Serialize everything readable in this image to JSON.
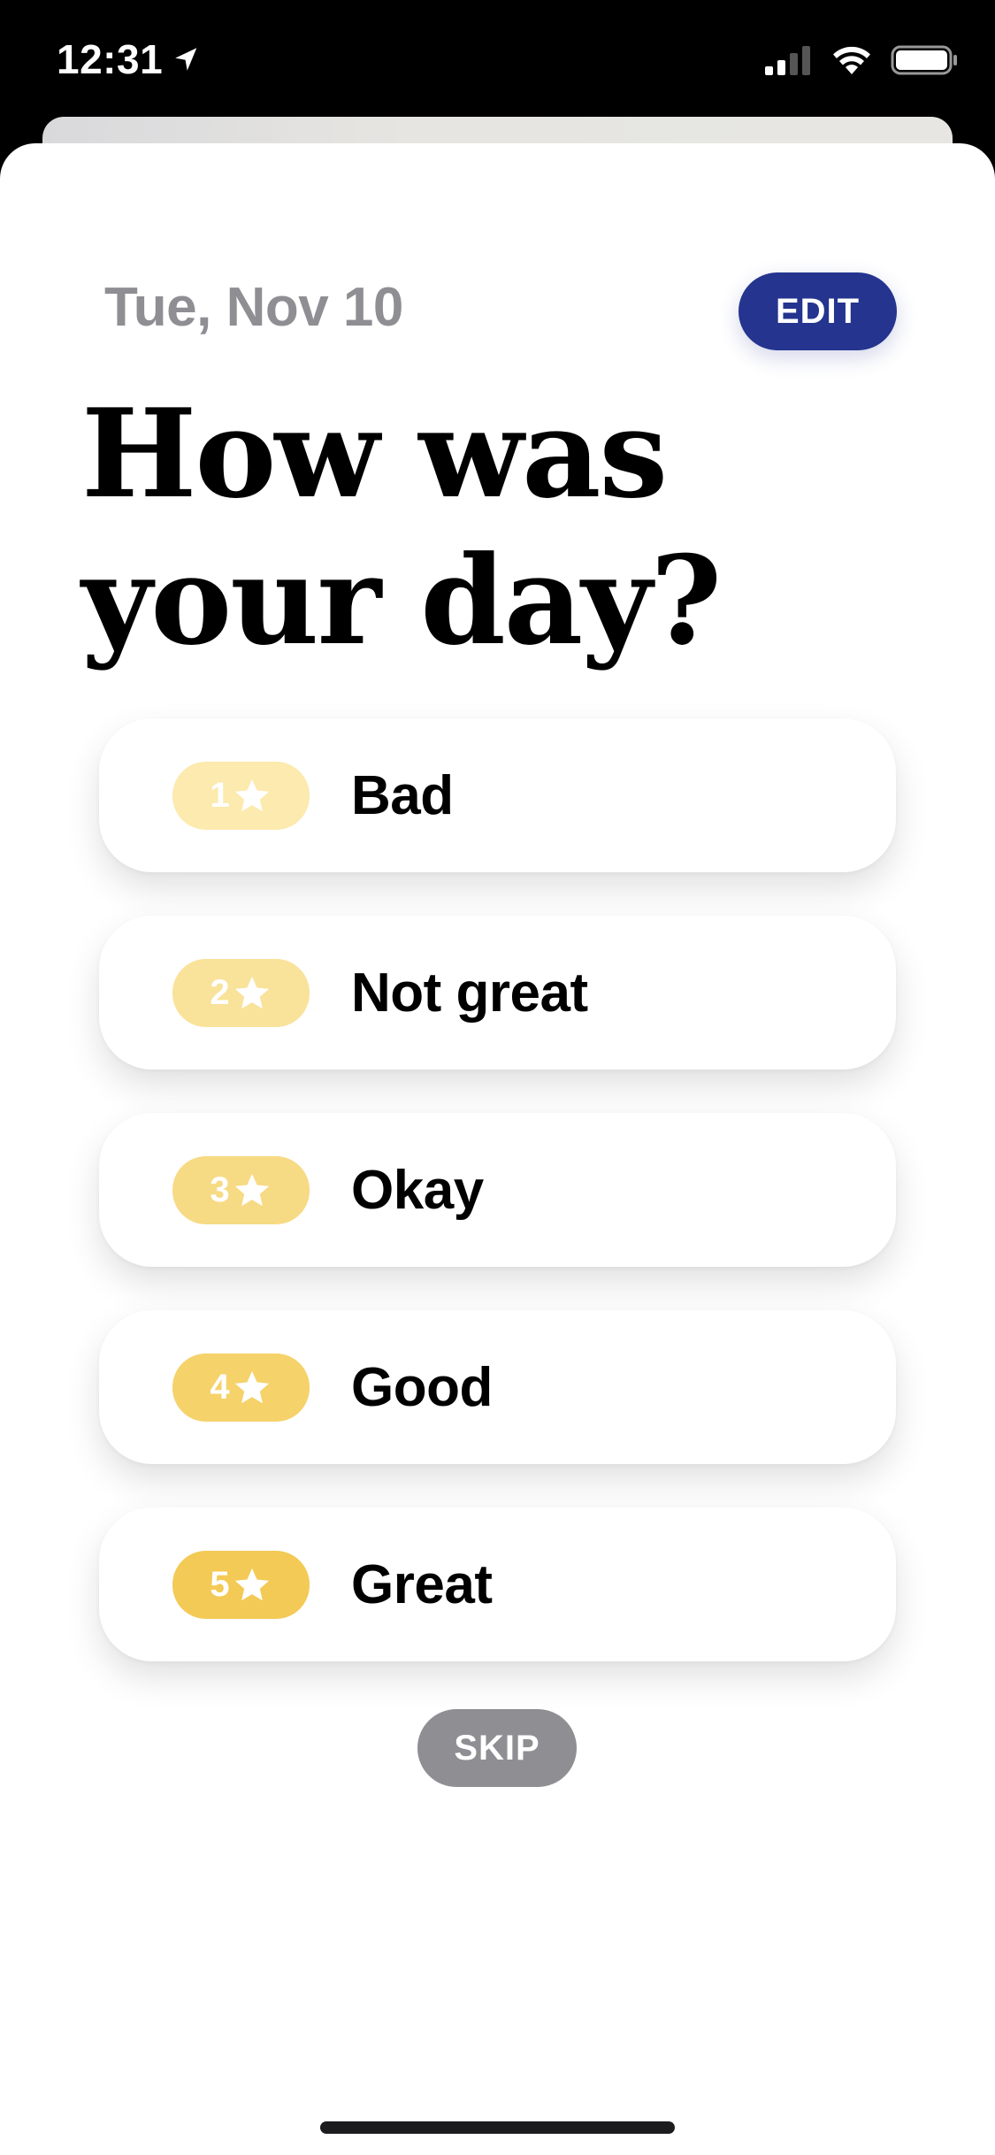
{
  "status_bar": {
    "time": "12:31",
    "icons": [
      "location-arrow-icon",
      "cellular-signal-icon",
      "wifi-icon",
      "battery-icon"
    ]
  },
  "header": {
    "date": "Tue, Nov 10",
    "edit_label": "EDIT"
  },
  "title": {
    "line1": "How was",
    "line2": "your day?"
  },
  "options": [
    {
      "rating": "1",
      "label": "Bad",
      "badge_color": "#FCEAAE"
    },
    {
      "rating": "2",
      "label": "Not great",
      "badge_color": "#F9E29A"
    },
    {
      "rating": "3",
      "label": "Okay",
      "badge_color": "#F7DA84"
    },
    {
      "rating": "4",
      "label": "Good",
      "badge_color": "#F5D26A"
    },
    {
      "rating": "5",
      "label": "Great",
      "badge_color": "#F3CA55"
    }
  ],
  "skip_label": "SKIP",
  "colors": {
    "accent": "#24348F",
    "muted": "#8E8E93"
  }
}
